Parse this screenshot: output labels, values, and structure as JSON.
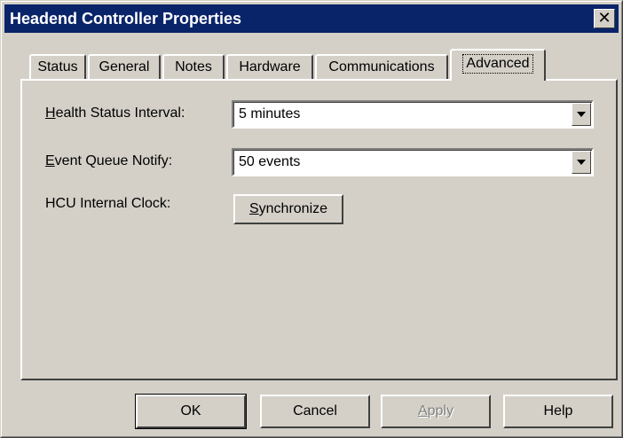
{
  "window": {
    "title": "Headend Controller Properties",
    "close_label": "✕"
  },
  "tabs": [
    {
      "label": "Status",
      "active": false
    },
    {
      "label": "General",
      "active": false
    },
    {
      "label": "Notes",
      "active": false
    },
    {
      "label": "Hardware",
      "active": false
    },
    {
      "label": "Communications",
      "active": false
    },
    {
      "label": "Advanced",
      "active": true
    }
  ],
  "advanced": {
    "health_status": {
      "label_mnemonic": "H",
      "label_rest": "ealth Status Interval:",
      "value": "5 minutes"
    },
    "event_queue": {
      "label_mnemonic": "E",
      "label_rest": "vent Queue Notify:",
      "value": "50 events"
    },
    "hcu_clock": {
      "label": "HCU Internal Clock:",
      "button_mnemonic": "S",
      "button_rest": "ynchronize"
    }
  },
  "buttons": {
    "ok": "OK",
    "cancel": "Cancel",
    "apply_mnemonic": "A",
    "apply_rest": "pply",
    "help": "Help"
  },
  "icons": {
    "close": "close-icon",
    "dropdown": "chevron-down-icon"
  }
}
